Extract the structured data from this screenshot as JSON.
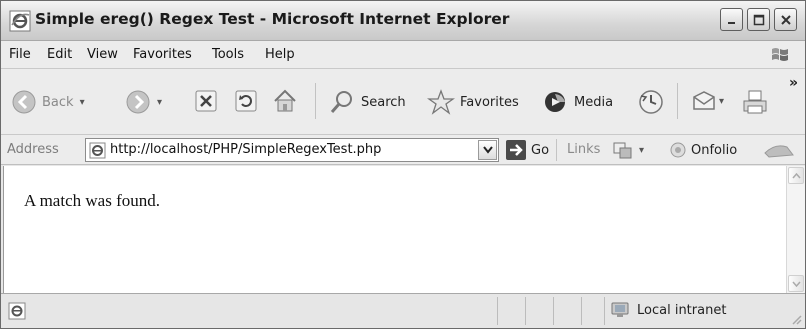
{
  "window": {
    "title": "Simple ereg() Regex Test - Microsoft Internet Explorer",
    "controls": {
      "minimize": "minimize",
      "maximize": "maximize",
      "close": "close"
    }
  },
  "menubar": {
    "items": [
      "File",
      "Edit",
      "View",
      "Favorites",
      "Tools",
      "Help"
    ]
  },
  "toolbar": {
    "back_label": "Back",
    "search_label": "Search",
    "favorites_label": "Favorites",
    "media_label": "Media",
    "overflow": "»",
    "icons": [
      "back-arrow-icon",
      "forward-arrow-icon",
      "stop-icon",
      "refresh-icon",
      "home-icon",
      "search-icon",
      "favorites-star-icon",
      "media-icon",
      "history-icon",
      "mail-icon",
      "print-icon"
    ]
  },
  "addressbar": {
    "label": "Address",
    "url": "http://localhost/PHP/SimpleRegexTest.php",
    "go_label": "Go",
    "links_label": "Links",
    "onfolio_label": "Onfolio"
  },
  "page": {
    "message": "A match was found."
  },
  "statusbar": {
    "zone": "Local intranet"
  },
  "colors": {
    "chrome": "#ececec",
    "titlebar": "#d6d6d6",
    "go_arrow": "#2d7d2d"
  }
}
